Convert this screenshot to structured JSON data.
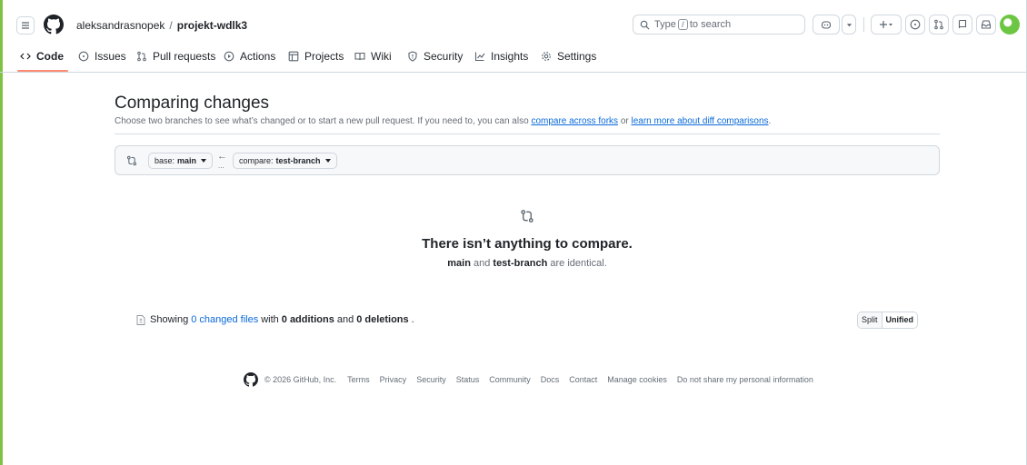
{
  "header": {
    "owner": "aleksandrasnopek",
    "separator": "/",
    "repo": "projekt-wdlk3",
    "search_prefix": "Type",
    "search_key": "/",
    "search_suffix": "to search"
  },
  "tabs": [
    {
      "label": "Code",
      "icon": "code-icon"
    },
    {
      "label": "Issues",
      "icon": "issue-icon"
    },
    {
      "label": "Pull requests",
      "icon": "pull-request-icon"
    },
    {
      "label": "Actions",
      "icon": "play-icon"
    },
    {
      "label": "Projects",
      "icon": "table-icon"
    },
    {
      "label": "Wiki",
      "icon": "book-icon"
    },
    {
      "label": "Security",
      "icon": "shield-icon"
    },
    {
      "label": "Insights",
      "icon": "graph-icon"
    },
    {
      "label": "Settings",
      "icon": "gear-icon"
    }
  ],
  "compare": {
    "title": "Comparing changes",
    "subtitle_1": "Choose two branches to see what’s changed or to start a new pull request. If you need to, you can also",
    "link_forks": "compare across forks",
    "subtitle_or": "or",
    "link_learn": "learn more about diff comparisons",
    "subtitle_end": ".",
    "base_prefix": "base:",
    "base_branch": "main",
    "compare_prefix": "compare:",
    "compare_branch": "test-branch",
    "arrow": "←",
    "dots": "..."
  },
  "blankslate": {
    "title": "There isn’t anything to compare.",
    "branch_a": "main",
    "and": "and",
    "branch_b": "test-branch",
    "tail": "are identical."
  },
  "summary": {
    "showing": "Showing",
    "files_link": "0 changed files",
    "with": "with",
    "additions": "0 additions",
    "and": "and",
    "deletions": "0 deletions",
    "end": ".",
    "split": "Split",
    "unified": "Unified"
  },
  "footer": {
    "copyright": "© 2026 GitHub, Inc.",
    "links": [
      "Terms",
      "Privacy",
      "Security",
      "Status",
      "Community",
      "Docs",
      "Contact",
      "Manage cookies",
      "Do not share my personal information"
    ]
  },
  "colors": {
    "accent_link": "#0969da",
    "tab_underline": "#fd8c73",
    "border": "#d0d7de"
  }
}
